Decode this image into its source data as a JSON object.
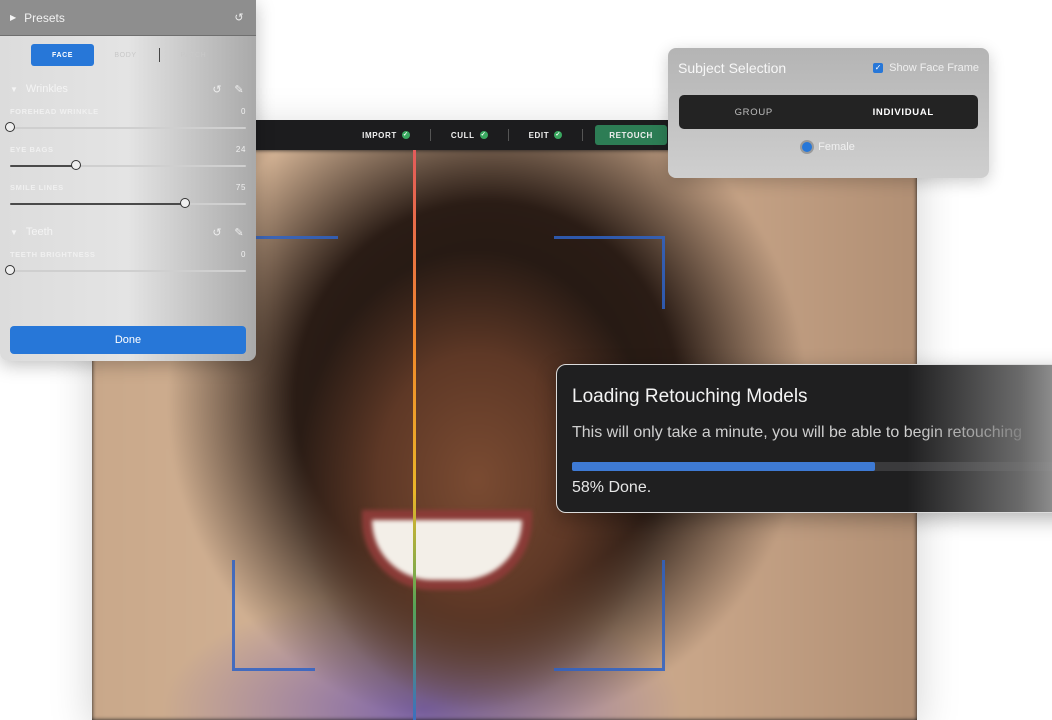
{
  "app_toolbar": {
    "items": [
      {
        "label": "IMPORT",
        "done": true
      },
      {
        "label": "CULL",
        "done": true
      },
      {
        "label": "EDIT",
        "done": true
      },
      {
        "label": "RETOUCH",
        "active": true
      }
    ],
    "check_glyph": "✓"
  },
  "presets_panel": {
    "title": "Presets",
    "tabs": [
      {
        "label": "FACE",
        "active": true
      },
      {
        "label": "BODY"
      },
      {
        "label": "PATCH"
      }
    ],
    "sections": [
      {
        "name": "Wrinkles",
        "sliders": [
          {
            "label": "FOREHEAD WRINKLE",
            "value": "0",
            "percent": 0
          },
          {
            "label": "EYE BAGS",
            "value": "24",
            "percent": 28
          },
          {
            "label": "SMILE LINES",
            "value": "75",
            "percent": 74
          }
        ]
      },
      {
        "name": "Teeth",
        "sliders": [
          {
            "label": "TEETH BRIGHTNESS",
            "value": "0",
            "percent": 0
          }
        ]
      }
    ],
    "done_label": "Done"
  },
  "subject_selection": {
    "title": "Subject Selection",
    "show_face_frame_label": "Show Face Frame",
    "show_face_frame_checked": true,
    "segments": [
      {
        "label": "GROUP",
        "active": false
      },
      {
        "label": "INDIVIDUAL",
        "active": true
      }
    ],
    "radio_label": "Female"
  },
  "loading": {
    "title": "Loading Retouching Models",
    "message": "This will only take a minute, you will be able to begin retouching",
    "progress_fraction": 0.58,
    "percent_label": "58% Done."
  },
  "colors": {
    "accent": "#2777d8",
    "progress": "#3e7ad4",
    "success": "#3aa860",
    "retouch_tab": "#2d7d55"
  }
}
